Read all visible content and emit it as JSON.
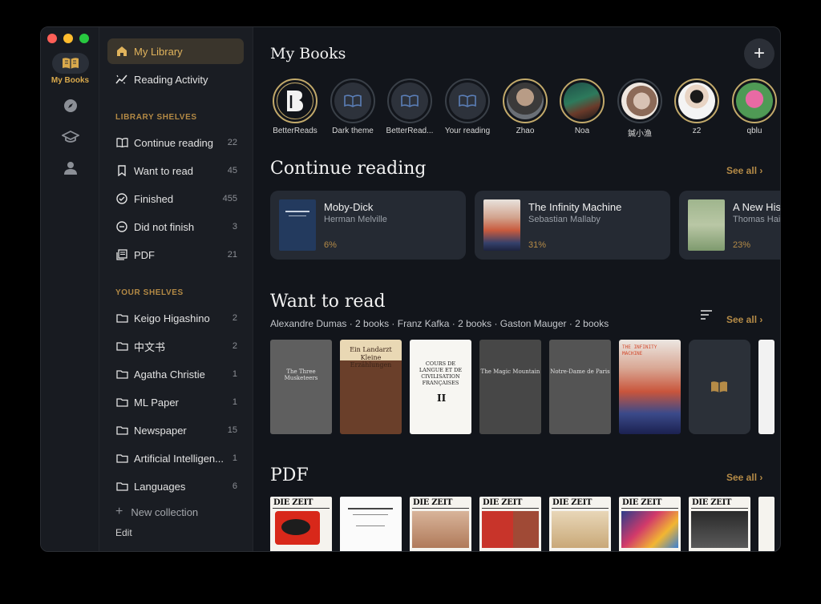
{
  "rail": {
    "items": [
      {
        "label": "My Books",
        "icon": "open-book-icon"
      },
      {
        "label": "",
        "icon": "compass-icon"
      },
      {
        "label": "",
        "icon": "graduation-cap-icon"
      },
      {
        "label": "",
        "icon": "person-icon"
      }
    ]
  },
  "sidebar": {
    "nav": [
      {
        "label": "My Library",
        "icon": "home-icon",
        "active": true
      },
      {
        "label": "Reading Activity",
        "icon": "activity-icon",
        "active": false
      }
    ],
    "library_shelves_title": "LIBRARY SHELVES",
    "library_shelves": [
      {
        "label": "Continue reading",
        "count": "22",
        "icon": "open-book-icon"
      },
      {
        "label": "Want to read",
        "count": "45",
        "icon": "bookmark-icon"
      },
      {
        "label": "Finished",
        "count": "455",
        "icon": "check-circle-icon"
      },
      {
        "label": "Did not finish",
        "count": "3",
        "icon": "minus-circle-icon"
      },
      {
        "label": "PDF",
        "count": "21",
        "icon": "pdf-icon"
      }
    ],
    "your_shelves_title": "YOUR SHELVES",
    "your_shelves": [
      {
        "label": "Keigo Higashino",
        "count": "2"
      },
      {
        "label": "中文书",
        "count": "2"
      },
      {
        "label": "Agatha Christie",
        "count": "1"
      },
      {
        "label": "ML Paper",
        "count": "1"
      },
      {
        "label": "Newspaper",
        "count": "15"
      },
      {
        "label": "Artificial Intelligen...",
        "count": "1"
      },
      {
        "label": "Languages",
        "count": "6"
      }
    ],
    "new_collection": "New collection",
    "edit": "Edit"
  },
  "main": {
    "title": "My Books",
    "add_symbol": "+",
    "stories": [
      {
        "name": "BetterReads"
      },
      {
        "name": "Dark theme"
      },
      {
        "name": "BetterRead..."
      },
      {
        "name": "Your reading"
      },
      {
        "name": "Zhao"
      },
      {
        "name": "Noa"
      },
      {
        "name": "鍼小渔"
      },
      {
        "name": "z2"
      },
      {
        "name": "qblu"
      }
    ],
    "continue": {
      "title": "Continue reading",
      "see_all": "See all ›",
      "books": [
        {
          "title": "Moby-Dick",
          "author": "Herman Melville",
          "progress": "6%"
        },
        {
          "title": "The Infinity Machine",
          "author": "Sebastian Mallaby",
          "progress": "31%"
        },
        {
          "title": "A New History of Modern Computing",
          "author": "Thomas Haigh",
          "progress": "23%"
        }
      ]
    },
    "want": {
      "title": "Want to read",
      "see_all": "See all ›",
      "subtitle": "Alexandre Dumas · 2 books · Franz Kafka · 2 books · Gaston Mauger · 2 books",
      "books": [
        {
          "title": "The Three Musketeers"
        },
        {
          "title": "Ein Landarzt Kleine Erzählungen"
        },
        {
          "title": "COURS DE LANGUE ET DE CIVILISATION FRANÇAISES"
        },
        {
          "title": "The Magic Mountain"
        },
        {
          "title": "Notre-Dame de Paris"
        },
        {
          "title": "THE INFINITY MACHINE"
        },
        {
          "title": ""
        }
      ]
    },
    "pdf": {
      "title": "PDF",
      "see_all": "See all ›",
      "masthead": "DIE ZEIT"
    }
  }
}
